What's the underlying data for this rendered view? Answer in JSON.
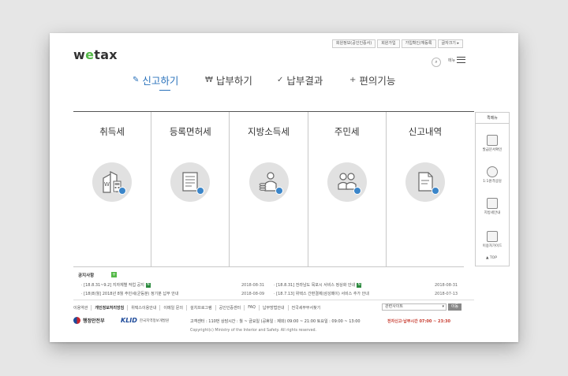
{
  "top_nav": [
    "회원정보(공인인증서)",
    "회원가입",
    "가입확인/재등록",
    "글자크기 ▸"
  ],
  "logo": {
    "pre": "w",
    "o": "e",
    "post": "tax"
  },
  "menu_label": "메뉴",
  "gnb": [
    {
      "label": "신고하기",
      "icon": "✎"
    },
    {
      "label": "납부하기",
      "icon": "₩"
    },
    {
      "label": "납부결과",
      "icon": "✓"
    },
    {
      "label": "편의기능",
      "icon": "+"
    }
  ],
  "tiles": [
    {
      "title": "취득세",
      "icon": "building-calculator-icon"
    },
    {
      "title": "등록면허세",
      "icon": "document-list-icon"
    },
    {
      "title": "지방소득세",
      "icon": "person-coins-icon"
    },
    {
      "title": "주민세",
      "icon": "people-icon"
    },
    {
      "title": "신고내역",
      "icon": "document-history-icon"
    }
  ],
  "quick_menu": {
    "title": "퀵메뉴",
    "items": [
      "발급문서확인",
      "1:1원격상담",
      "지방세안내",
      "이용자가이드"
    ],
    "top": "TOP"
  },
  "notices": {
    "title": "공지사항",
    "plus": "+",
    "left": [
      {
        "text": "· [18.8.31~9.2] 지자체별 작업 공지",
        "badge": "N",
        "date": "2018-08-31"
      },
      {
        "text": "· [18(8)월] 2018년 8월 주민세(균등분) 정기분 납부 안내",
        "badge": "",
        "date": "2018-08-09"
      }
    ],
    "right": [
      {
        "text": "· [18.8.31] 전라남도 목포시 서비스 정상화 안내",
        "badge": "N",
        "date": "2018-08-31"
      },
      {
        "text": "· [18.7.13] 위택스 간편결제(삼성페이) 서비스 추가 안내",
        "badge": "",
        "date": "2018-07-13"
      }
    ]
  },
  "footer_nav": [
    "이용약관",
    "개인정보처리방침",
    "위택스이용안내",
    "이메일 문의",
    "설치프로그램",
    "공인인증센터",
    "FAQ",
    "납부방법안내",
    "전국세무부서찾기"
  ],
  "footer_select": {
    "placeholder": "관련사이트",
    "go": "이동"
  },
  "ministry": "행정안전부",
  "klid": {
    "mark": "KLID",
    "name": "한국지역정보개발원"
  },
  "contact": "고객센터 : 110번   상담시간 : 월 ~ 금요일 (공휴일 : 제외) 09:00 ~ 21:00 토요일 : 09:00 ~ 13:00",
  "hours": "전자신고·납부시간 07:00 ~ 23:30",
  "copyright": "Copyright(c) Ministry of the Interior and Safety. All rights reserved."
}
